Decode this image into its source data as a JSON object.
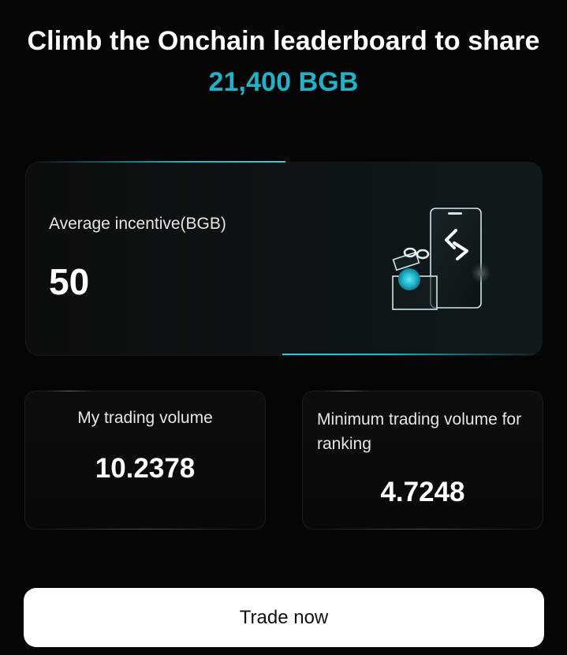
{
  "header": {
    "title_prefix": "Climb the Onchain leaderboard to share ",
    "title_amount": "21,400 BGB"
  },
  "incentive": {
    "label": "Average incentive(BGB)",
    "value": "50",
    "illustration_icon": "gift-phone-swap-icon"
  },
  "stats": {
    "my_volume": {
      "label": "My trading volume",
      "value": "10.2378"
    },
    "min_volume": {
      "label": "Minimum trading volume for ranking",
      "value": "4.7248"
    }
  },
  "cta": {
    "label": "Trade now"
  },
  "colors": {
    "accent": "#1fb3c9",
    "background": "#050505",
    "button_bg": "#ffffff"
  }
}
